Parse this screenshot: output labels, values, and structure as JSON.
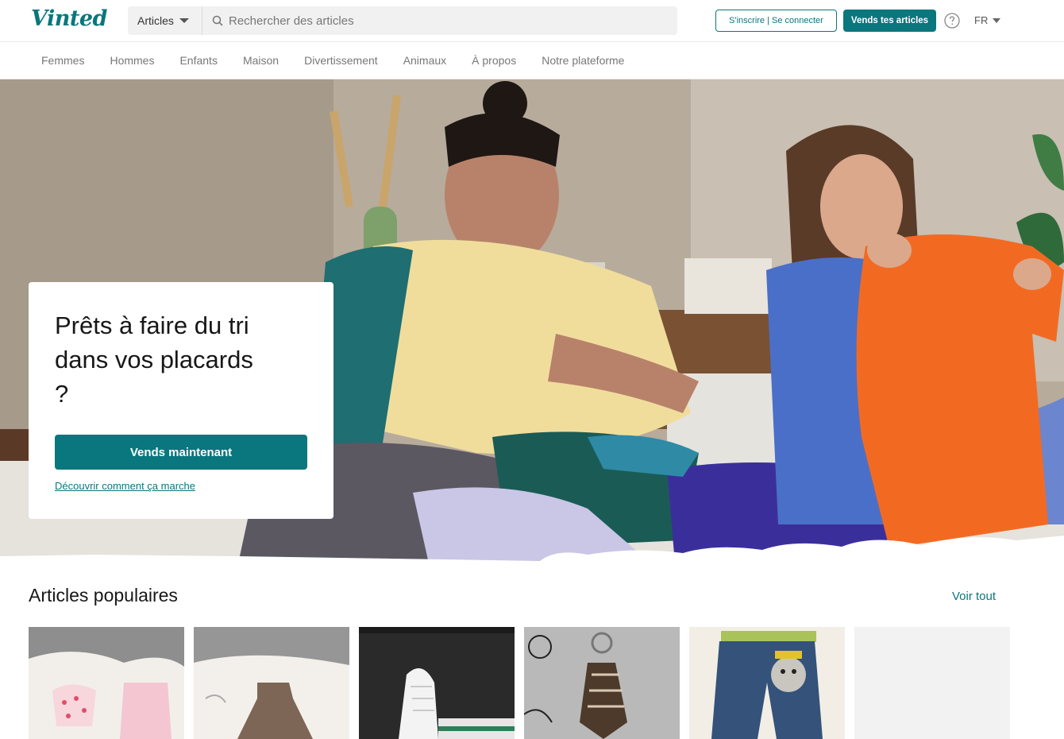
{
  "header": {
    "logo": "Vinted",
    "search_category": "Articles",
    "search_placeholder": "Rechercher des articles",
    "login_label": "S'inscrire | Se connecter",
    "sell_label": "Vends tes articles",
    "language": "FR"
  },
  "nav": {
    "items": [
      "Femmes",
      "Hommes",
      "Enfants",
      "Maison",
      "Divertissement",
      "Animaux",
      "À propos",
      "Notre plateforme"
    ]
  },
  "hero": {
    "title": "Prêts à faire du tri dans vos placards ?",
    "button_label": "Vends maintenant",
    "link_label": "Découvrir comment ça marche"
  },
  "popular": {
    "title": "Articles populaires",
    "see_all": "Voir tout"
  },
  "colors": {
    "brand": "#09777d",
    "text": "#171717",
    "muted": "#777777"
  },
  "icons": [
    "search-icon",
    "help-icon",
    "chevron-down-icon"
  ]
}
